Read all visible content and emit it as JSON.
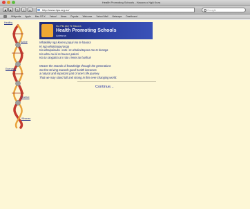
{
  "browser": {
    "window_title": "Health Promoting Schools - Hauora o Ngã Kura",
    "url": "http://www.hps.org.nz/",
    "search_placeholder": "Google",
    "bookmarks": [
      "Wikipedia",
      "Apple",
      "Mac OS X",
      "Yahoo!",
      "News",
      "Popular",
      "Welcome",
      "Yahoo! Mail",
      "Netscape",
      "Dashboard"
    ]
  },
  "sidebar": {
    "labels": [
      "Healthy",
      "Active",
      "Energetic",
      "Positive",
      "Whanau"
    ]
  },
  "banner": {
    "tagline": "Kia Piki Ake Te Hauora",
    "title": "Health Promoting Schools",
    "region": "Aotearoa"
  },
  "poem": {
    "stanza1": [
      "Whakitiky nga korero papai mo te hauora",
      "Ki nga whakatupuranga",
      "Kia whaipainuku i roto i te whakaritepara mo te tinanga",
      "Kia whai nui ki te hauora pakari",
      "Kia tu rangatira ai i roto i tenei ao hurihuri"
    ],
    "stanza2": [
      "Weave the strands of knowledge through the generations",
      "So that striving towards good health becomes",
      "a natural and important part of one's life journey.",
      "That we may stand tall and strong in this ever-changing world."
    ]
  },
  "continue_label": "Continue...",
  "colors": {
    "page_background": "#fdf7d6",
    "banner_blue": "#2a3b9a",
    "text_navy": "#1a2c88",
    "helix_red": "#c43a2f",
    "helix_orange": "#e9a33c"
  }
}
